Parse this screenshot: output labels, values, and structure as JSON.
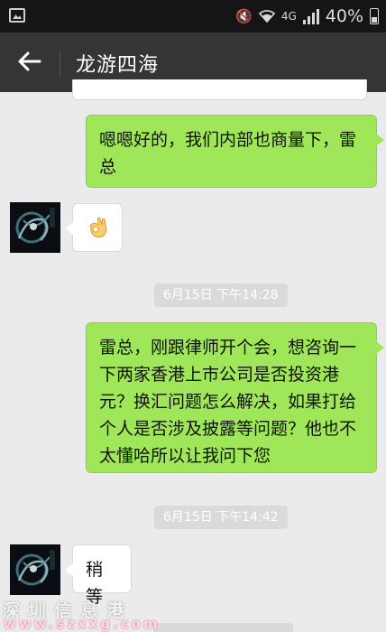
{
  "status_bar": {
    "icons": [
      "gallery-icon",
      "mute-icon",
      "wifi-icon",
      "signal-icon",
      "battery-icon"
    ],
    "network": "4G",
    "battery": "40%"
  },
  "header": {
    "title": "龙游四海",
    "back_icon": "arrow-left-icon"
  },
  "messages": [
    {
      "type": "sent",
      "text": "嗯嗯好的，我们内部也商量下，雷总"
    },
    {
      "type": "received",
      "content": "ok-hand-emoji"
    },
    {
      "type": "timestamp",
      "text": "6月15日 下午14:28"
    },
    {
      "type": "sent",
      "text": "雷总，刚跟律师开个会，想咨询一下两家香港上市公司是否投资港元？换汇问题怎么解决，如果打给个人是否涉及披露等问题？他也不太懂哈所以让我问下您"
    },
    {
      "type": "timestamp",
      "text": "6月15日 下午14:42"
    },
    {
      "type": "received",
      "text": "稍等"
    }
  ],
  "watermark": {
    "line1": "深圳信息港",
    "line2": "www.szxxg.com"
  },
  "colors": {
    "sent_bubble": "#9fe658",
    "received_bubble": "#ffffff",
    "app_bar": "#353535",
    "status_bar": "#151515",
    "chat_background": "#ebebeb"
  }
}
